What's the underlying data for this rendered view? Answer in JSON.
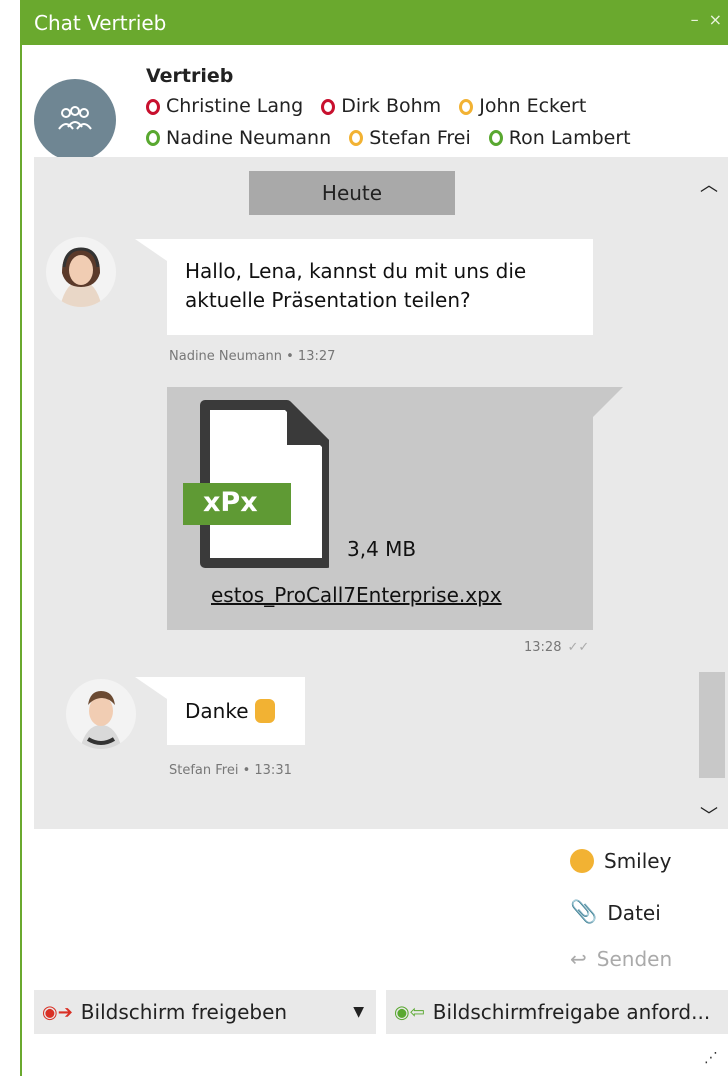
{
  "window": {
    "title": "Chat Vertrieb",
    "minimize": "–",
    "close": "×"
  },
  "group": {
    "name": "Vertrieb",
    "members": [
      {
        "name": "Christine Lang",
        "status_color": "#c8102e"
      },
      {
        "name": "Dirk Bohm",
        "status_color": "#c8102e"
      },
      {
        "name": "John Eckert",
        "status_color": "#f2b233"
      },
      {
        "name": "Nadine Neumann",
        "status_color": "#59a830"
      },
      {
        "name": "Stefan Frei",
        "status_color": "#f2b233"
      },
      {
        "name": "Ron Lambert",
        "status_color": "#59a830"
      }
    ]
  },
  "chat": {
    "day_label": "Heute",
    "messages": [
      {
        "text_line1": "Hallo, Lena, kannst du mit uns die",
        "text_line2": "aktuelle Präsentation teilen?",
        "meta": "Nadine Neumann • 13:27"
      },
      {
        "file_badge": "xPx",
        "file_size": "3,4 MB",
        "file_name": "estos_ProCall7Enterprise.xpx",
        "meta": "13:28"
      },
      {
        "text": "Danke",
        "meta": "Stefan Frei • 13:31"
      }
    ]
  },
  "composer": {
    "smiley": "Smiley",
    "file": "Datei",
    "send": "Senden"
  },
  "bottom": {
    "share_screen": "Bildschirm freigeben",
    "request_share": "Bildschirmfreigabe anford..."
  },
  "colors": {
    "accent": "#6aa92e",
    "bubble_gray": "#c8c8c8",
    "panel_gray": "#e9e9e9"
  }
}
